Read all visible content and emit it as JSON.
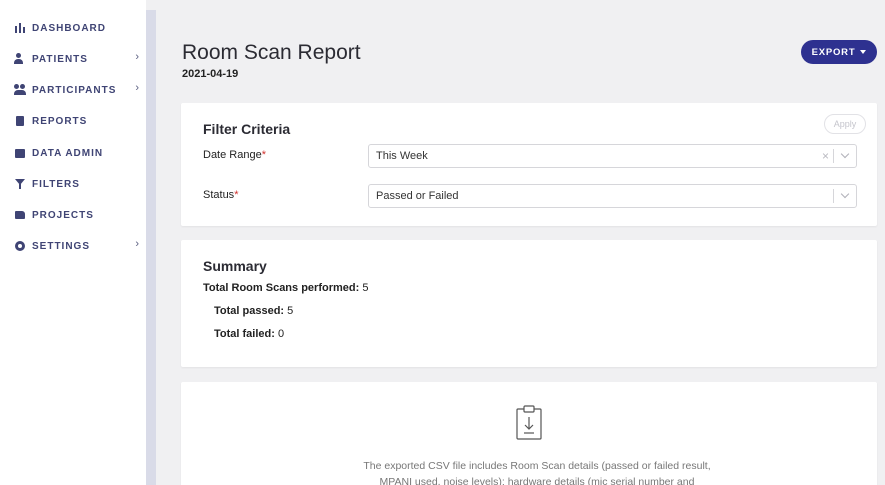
{
  "sidebar": {
    "items": [
      {
        "label": "DASHBOARD",
        "icon": "dashboard-icon",
        "has_submenu": false
      },
      {
        "label": "PATIENTS",
        "icon": "patient-icon",
        "has_submenu": true
      },
      {
        "label": "PARTICIPANTS",
        "icon": "participants-icon",
        "has_submenu": true
      },
      {
        "label": "REPORTS",
        "icon": "reports-icon",
        "has_submenu": false
      },
      {
        "label": "DATA ADMIN",
        "icon": "data-admin-icon",
        "has_submenu": false
      },
      {
        "label": "FILTERS",
        "icon": "filter-icon",
        "has_submenu": false
      },
      {
        "label": "PROJECTS",
        "icon": "projects-icon",
        "has_submenu": false
      },
      {
        "label": "SETTINGS",
        "icon": "gear-icon",
        "has_submenu": true
      }
    ],
    "chevron": "›"
  },
  "header": {
    "title": "Room Scan Report",
    "date": "2021-04-19",
    "export_label": "EXPORT"
  },
  "filter": {
    "heading": "Filter Criteria",
    "apply_label": "Apply",
    "date_range_label": "Date Range",
    "date_range_value": "This Week",
    "status_label": "Status",
    "status_value": "Passed or Failed",
    "required_mark": "*",
    "clear_glyph": "×"
  },
  "summary": {
    "heading": "Summary",
    "total_label": "Total Room Scans performed:",
    "total_value": "5",
    "passed_label": "Total passed:",
    "passed_value": "5",
    "failed_label": "Total failed:",
    "failed_value": "0"
  },
  "export_info": {
    "line1": "The exported CSV file includes Room Scan details (passed or failed result,",
    "line2": "MPANI used, noise levels); hardware details (mic serial number and"
  },
  "colors": {
    "accent": "#2e3190",
    "nav_text": "#3f4474",
    "required": "#d0312d"
  }
}
